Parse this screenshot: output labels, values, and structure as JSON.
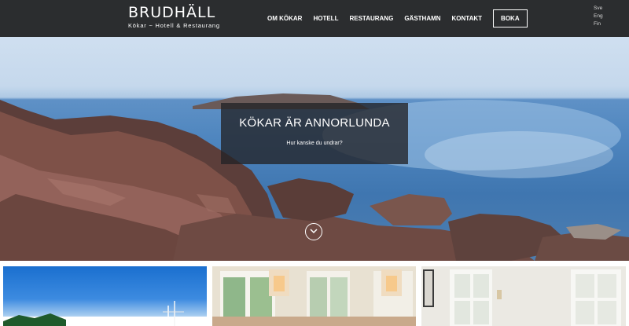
{
  "brand": {
    "name": "BRUDHÄLL",
    "tagline": "Kökar ~ Hotell & Restaurang"
  },
  "nav": {
    "items": [
      "OM KÖKAR",
      "HOTELL",
      "RESTAURANG",
      "GÄSTHAMN",
      "KONTAKT"
    ],
    "book_label": "BOKA"
  },
  "languages": [
    "Sve",
    "Eng",
    "Fin"
  ],
  "hero": {
    "title": "KÖKAR ÄR ANNORLUNDA",
    "subtitle": "Hur kanske du undrar?",
    "scroll_icon": "chevron-down-icon"
  },
  "colors": {
    "header_bg": "#2b2d2f",
    "text": "#ffffff"
  }
}
